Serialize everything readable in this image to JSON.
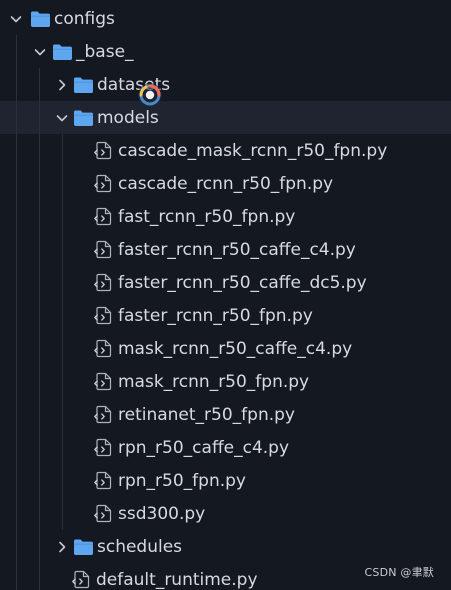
{
  "explorer": {
    "items": [
      {
        "type": "folder",
        "depth": 0,
        "expanded": true,
        "label": "configs"
      },
      {
        "type": "folder",
        "depth": 1,
        "expanded": true,
        "label": "_base_"
      },
      {
        "type": "folder",
        "depth": 2,
        "expanded": false,
        "label": "datasets"
      },
      {
        "type": "folder",
        "depth": 2,
        "expanded": true,
        "label": "models",
        "hover": true
      },
      {
        "type": "file",
        "depth": 3,
        "label": "cascade_mask_rcnn_r50_fpn.py"
      },
      {
        "type": "file",
        "depth": 3,
        "label": "cascade_rcnn_r50_fpn.py"
      },
      {
        "type": "file",
        "depth": 3,
        "label": "fast_rcnn_r50_fpn.py"
      },
      {
        "type": "file",
        "depth": 3,
        "label": "faster_rcnn_r50_caffe_c4.py"
      },
      {
        "type": "file",
        "depth": 3,
        "label": "faster_rcnn_r50_caffe_dc5.py"
      },
      {
        "type": "file",
        "depth": 3,
        "label": "faster_rcnn_r50_fpn.py"
      },
      {
        "type": "file",
        "depth": 3,
        "label": "mask_rcnn_r50_caffe_c4.py"
      },
      {
        "type": "file",
        "depth": 3,
        "label": "mask_rcnn_r50_fpn.py"
      },
      {
        "type": "file",
        "depth": 3,
        "label": "retinanet_r50_fpn.py"
      },
      {
        "type": "file",
        "depth": 3,
        "label": "rpn_r50_caffe_c4.py"
      },
      {
        "type": "file",
        "depth": 3,
        "label": "rpn_r50_fpn.py"
      },
      {
        "type": "file",
        "depth": 3,
        "label": "ssd300.py"
      },
      {
        "type": "folder",
        "depth": 2,
        "expanded": false,
        "label": "schedules"
      },
      {
        "type": "file",
        "depth": 2,
        "label": "default_runtime.py"
      }
    ]
  },
  "watermark": "CSDN @聿默",
  "icons": {
    "folder": "folder-icon",
    "file": "python-file-icon",
    "expanded": "chevron-down-icon",
    "collapsed": "chevron-right-icon",
    "cursor": "loading-cursor-icon"
  },
  "colors": {
    "background": "#141820",
    "hover_row": "#1f2430",
    "folder": "#5ea6f0",
    "text": "#d7dae0",
    "chevron": "#c5c8ce"
  }
}
